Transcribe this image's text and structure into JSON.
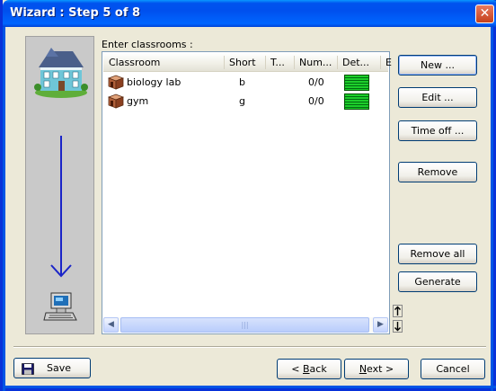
{
  "window": {
    "title": "Wizard : Step 5 of 8",
    "close_glyph": "✕"
  },
  "content": {
    "list_label": "Enter classrooms :"
  },
  "table": {
    "columns": [
      "Classroom",
      "Short",
      "T...",
      "Num...",
      "Det...",
      "E"
    ],
    "rows": [
      {
        "classroom": "biology lab",
        "short": "b",
        "t": "",
        "num": "0/0",
        "detail_color": "#1dce2b"
      },
      {
        "classroom": "gym",
        "short": "g",
        "t": "",
        "num": "0/0",
        "detail_color": "#1dce2b"
      }
    ],
    "scroll_grip": "|||"
  },
  "actions": {
    "new": "New ...",
    "edit": "Edit ...",
    "time_off": "Time off ...",
    "remove": "Remove",
    "remove_all": "Remove all",
    "generate": "Generate"
  },
  "footer": {
    "save": "Save",
    "back_prefix": "< ",
    "back_underlined": "B",
    "back_rest": "ack",
    "next_underlined": "N",
    "next_rest": "ext >",
    "cancel": "Cancel"
  },
  "icons": [
    "house-icon",
    "down-arrow-icon",
    "computer-icon",
    "room-icon",
    "save-disk-icon",
    "scroll-left-icon",
    "scroll-right-icon",
    "move-up-icon",
    "move-down-icon"
  ]
}
